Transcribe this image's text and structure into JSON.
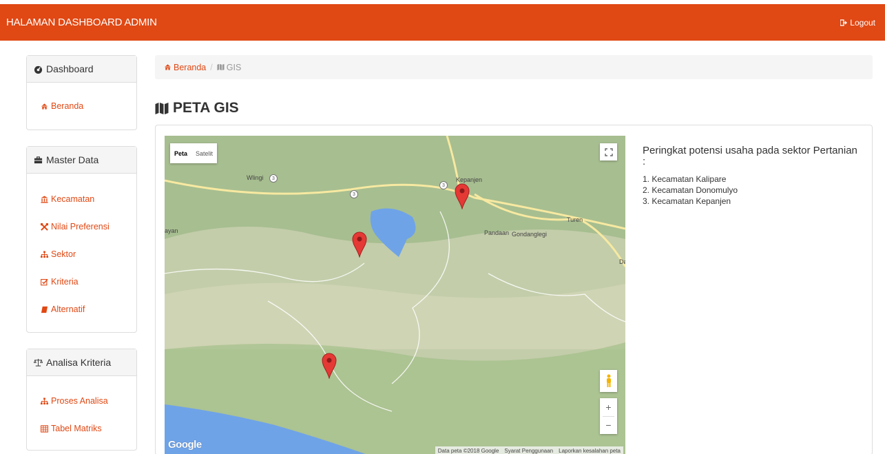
{
  "header": {
    "title": "HALAMAN DASHBOARD ADMIN",
    "logout_label": "Logout"
  },
  "sidebar": {
    "dashboard": {
      "title": "Dashboard",
      "items": [
        {
          "label": "Beranda",
          "icon": "home-icon"
        }
      ]
    },
    "master_data": {
      "title": "Master Data",
      "items": [
        {
          "label": "Kecamatan",
          "icon": "bank-icon"
        },
        {
          "label": "Nilai Preferensi",
          "icon": "crossed-arrows-icon"
        },
        {
          "label": "Sektor",
          "icon": "sitemap-icon"
        },
        {
          "label": "Kriteria",
          "icon": "edit-check-icon"
        },
        {
          "label": "Alternatif",
          "icon": "book-icon"
        }
      ]
    },
    "analisa": {
      "title": "Analisa Kriteria",
      "items": [
        {
          "label": "Proses Analisa",
          "icon": "sitemap-icon"
        },
        {
          "label": "Tabel Matriks",
          "icon": "table-icon"
        }
      ]
    }
  },
  "breadcrumb": {
    "home": "Beranda",
    "current": "GIS"
  },
  "page": {
    "title": "PETA GIS"
  },
  "map": {
    "type_active": "Peta",
    "type_inactive": "Satelit",
    "labels": [
      "Wlingi",
      "Kepanjen",
      "Pandaan",
      "Gondanglegi",
      "Turen",
      "ayan",
      "Da"
    ],
    "route_badge": "3",
    "google": "Google",
    "attribution": [
      "Data peta ©2018 Google",
      "Syarat Penggunaan",
      "Laporkan kesalahan peta"
    ],
    "zoom_in": "+",
    "zoom_out": "−"
  },
  "info": {
    "title": "Peringkat potensi usaha pada sektor Pertanian :",
    "ranking": [
      "1. Kecamatan Kalipare",
      "2. Kecamatan Donomulyo",
      "3. Kecamatan Kepanjen"
    ]
  },
  "colors": {
    "accent": "#e04814",
    "link": "#e04814",
    "marker": "#e53935",
    "water": "#6fa3e8"
  }
}
